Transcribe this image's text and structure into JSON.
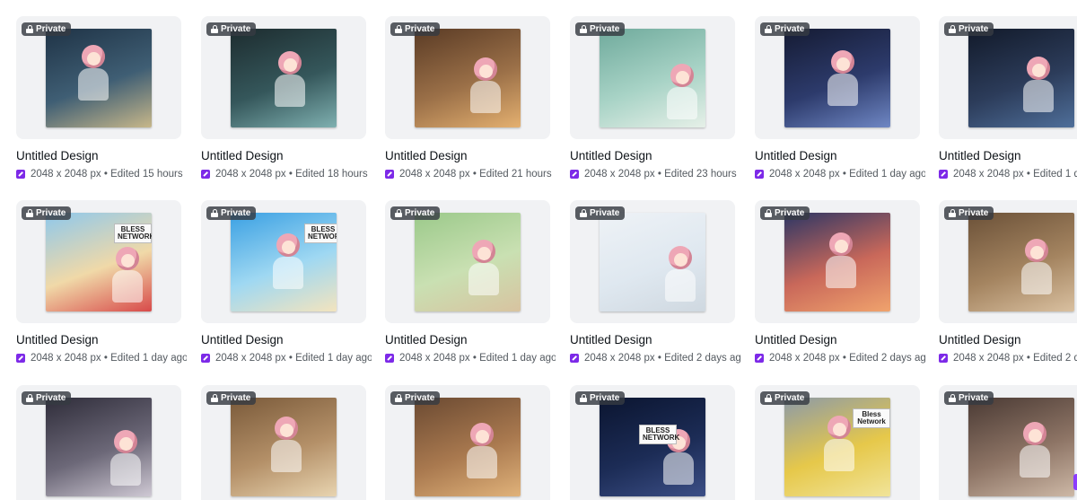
{
  "badge_label": "Private",
  "colors": {
    "accent": "#7d2ae8",
    "badge_bg": "#363a42",
    "thumb_bg": "#f1f2f4"
  },
  "rows": [
    [
      {
        "title": "Untitled Design",
        "dims": "2048 x 2048 px",
        "edited": "Edited 15 hours",
        "scene": "night-window-laptop",
        "colors": [
          "#1f3346",
          "#3f5e74",
          "#c7b78a"
        ]
      },
      {
        "title": "Untitled Design",
        "dims": "2048 x 2048 px",
        "edited": "Edited 18 hours",
        "scene": "headphones-computer",
        "colors": [
          "#1d2c2f",
          "#35575b",
          "#7fb0b0"
        ]
      },
      {
        "title": "Untitled Design",
        "dims": "2048 x 2048 px",
        "edited": "Edited 21 hours",
        "scene": "cooking-straw-hat",
        "colors": [
          "#5a3b25",
          "#9b7048",
          "#e4b070"
        ]
      },
      {
        "title": "Untitled Design",
        "dims": "2048 x 2048 px",
        "edited": "Edited 23 hours",
        "scene": "washing-laundry",
        "colors": [
          "#6faa9c",
          "#a8d3c6",
          "#e6f0e8"
        ]
      },
      {
        "title": "Untitled Design",
        "dims": "2048 x 2048 px",
        "edited": "Edited 1 day ago",
        "scene": "bed-glowing-lights",
        "colors": [
          "#151b33",
          "#2d3b6c",
          "#6f87c4"
        ]
      },
      {
        "title": "Untitled Design",
        "dims": "2048 x 2048 px",
        "edited": "Edited 1 d",
        "scene": "gaming-desk",
        "colors": [
          "#121a2a",
          "#2c3c5a",
          "#4f6f9a"
        ]
      }
    ],
    [
      {
        "title": "Untitled Design",
        "dims": "2048 x 2048 px",
        "edited": "Edited 1 day ago",
        "scene": "beach-chair",
        "sign": "BLESS NETWORK",
        "colors": [
          "#8ec8ec",
          "#f0d9a8",
          "#d84a4a"
        ]
      },
      {
        "title": "Untitled Design",
        "dims": "2048 x 2048 px",
        "edited": "Edited 1 day ago",
        "scene": "palm-beach-flag",
        "sign": "BLESS NETWORK",
        "colors": [
          "#3aa0e3",
          "#9fd8f2",
          "#f3e4be"
        ]
      },
      {
        "title": "Untitled Design",
        "dims": "2048 x 2048 px",
        "edited": "Edited 1 day ago",
        "scene": "group-walk-park",
        "colors": [
          "#9bc98a",
          "#c9e0b2",
          "#d8c3a0"
        ]
      },
      {
        "title": "Untitled Design",
        "dims": "2048 x 2048 px",
        "edited": "Edited 2 days ago",
        "scene": "verified-thought",
        "colors": [
          "#eef2f6",
          "#dfe8f0",
          "#cfd8e0"
        ]
      },
      {
        "title": "Untitled Design",
        "dims": "2048 x 2048 px",
        "edited": "Edited 2 days ag",
        "scene": "sunset-sea",
        "colors": [
          "#2c3665",
          "#c9685a",
          "#f0a36d"
        ]
      },
      {
        "title": "Untitled Design",
        "dims": "2048 x 2048 px",
        "edited": "Edited 2 d",
        "scene": "cafe-table",
        "colors": [
          "#6b5138",
          "#a48460",
          "#d9c0a0"
        ]
      }
    ],
    [
      {
        "title": "",
        "dims": "",
        "edited": "",
        "scene": "bed-laptop",
        "colors": [
          "#2f2d3a",
          "#6c6878",
          "#cfc9d4"
        ]
      },
      {
        "title": "",
        "dims": "",
        "edited": "",
        "scene": "kitchen-steam",
        "colors": [
          "#7a5a3a",
          "#b49068",
          "#e8d4b0"
        ]
      },
      {
        "title": "",
        "dims": "",
        "edited": "",
        "scene": "bathroom-mirror",
        "colors": [
          "#6b4a32",
          "#a9794f",
          "#e0b27a"
        ]
      },
      {
        "title": "",
        "dims": "",
        "edited": "",
        "scene": "night-sky-telescope",
        "sign": "BLESS NETWORK",
        "colors": [
          "#0b1530",
          "#1c2c56",
          "#3c4f86"
        ]
      },
      {
        "title": "",
        "dims": "",
        "edited": "",
        "scene": "yellow-car",
        "sign": "Bless Network",
        "colors": [
          "#8c9aa8",
          "#e6c84a",
          "#f1e49a"
        ]
      },
      {
        "title": "",
        "dims": "",
        "edited": "",
        "scene": "coffee-mug",
        "colors": [
          "#4a3a34",
          "#8d7465",
          "#cdb8a6"
        ]
      }
    ]
  ]
}
